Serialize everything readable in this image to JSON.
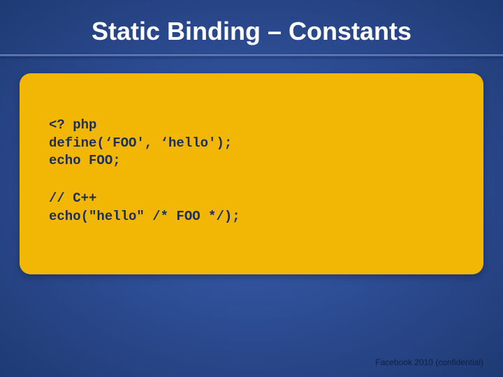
{
  "title": "Static Binding – Constants",
  "code": {
    "block1": "<? php\ndefine(‘FOO', ‘hello');\necho FOO;",
    "block2": "// C++\necho(\"hello\" /* FOO */);"
  },
  "footer": "Facebook 2010 (confidential)"
}
